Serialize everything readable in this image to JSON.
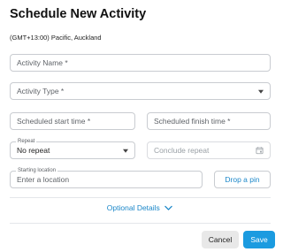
{
  "dialog": {
    "title": "Schedule New Activity",
    "timezone": "(GMT+13:00) Pacific, Auckland"
  },
  "form": {
    "activity_name": {
      "placeholder": "Activity Name *"
    },
    "activity_type": {
      "placeholder": "Activity Type *"
    },
    "start_time": {
      "placeholder": "Scheduled start time *"
    },
    "finish_time": {
      "placeholder": "Scheduled finish time *"
    },
    "repeat": {
      "label": "Repeat",
      "value": "No repeat"
    },
    "conclude_repeat": {
      "placeholder": "Conclude repeat"
    },
    "starting_location": {
      "label": "Starting location",
      "placeholder": "Enter a location"
    },
    "drop_pin_label": "Drop a pin"
  },
  "optional_details_label": "Optional Details",
  "footer": {
    "cancel_label": "Cancel",
    "save_label": "Save"
  },
  "colors": {
    "accent": "#1b87c9",
    "save_button": "#1b9be0",
    "cancel_button": "#e8e8e8"
  },
  "icons": {
    "activity_type_dropdown": "caret-down-icon",
    "repeat_dropdown": "caret-down-icon",
    "conclude_repeat": "calendar-icon",
    "optional_details": "chevron-down-icon"
  }
}
